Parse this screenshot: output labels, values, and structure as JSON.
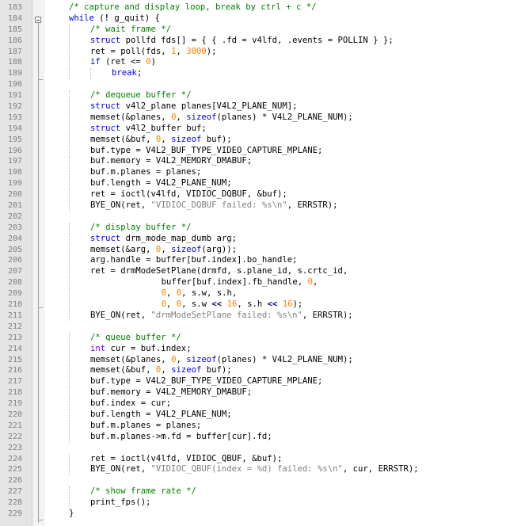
{
  "editor": {
    "lines": [
      {
        "n": "183",
        "indent": 1,
        "tokens": [
          [
            "cm",
            "/* capture and display loop, break by ctrl + c */"
          ]
        ]
      },
      {
        "n": "184",
        "indent": 1,
        "tokens": [
          [
            "kw",
            "while"
          ],
          [
            "tx",
            " ("
          ],
          [
            "op",
            "!"
          ],
          [
            "tx",
            " g_quit) {"
          ]
        ]
      },
      {
        "n": "185",
        "indent": 2,
        "tokens": [
          [
            "cm",
            "/* wait frame */"
          ]
        ]
      },
      {
        "n": "186",
        "indent": 2,
        "tokens": [
          [
            "kw",
            "struct"
          ],
          [
            "tx",
            " pollfd fds[] = { { .fd = v4lfd, .events = POLLIN } };"
          ]
        ]
      },
      {
        "n": "187",
        "indent": 2,
        "tokens": [
          [
            "tx",
            "ret = poll(fds, "
          ],
          [
            "nm",
            "1"
          ],
          [
            "tx",
            ", "
          ],
          [
            "nm",
            "3000"
          ],
          [
            "tx",
            ");"
          ]
        ]
      },
      {
        "n": "188",
        "indent": 2,
        "tokens": [
          [
            "kw",
            "if"
          ],
          [
            "tx",
            " (ret <= "
          ],
          [
            "nm",
            "0"
          ],
          [
            "tx",
            ")"
          ]
        ]
      },
      {
        "n": "189",
        "indent": 3,
        "tokens": [
          [
            "kw",
            "break"
          ],
          [
            "tx",
            ";"
          ]
        ]
      },
      {
        "n": "190",
        "indent": 0,
        "tokens": []
      },
      {
        "n": "191",
        "indent": 2,
        "tokens": [
          [
            "cm",
            "/* dequeue buffer */"
          ]
        ]
      },
      {
        "n": "192",
        "indent": 2,
        "tokens": [
          [
            "kw",
            "struct"
          ],
          [
            "tx",
            " v4l2_plane planes[V4L2_PLANE_NUM];"
          ]
        ]
      },
      {
        "n": "193",
        "indent": 2,
        "tokens": [
          [
            "tx",
            "memset(&planes, "
          ],
          [
            "nm",
            "0"
          ],
          [
            "tx",
            ", "
          ],
          [
            "kw",
            "sizeof"
          ],
          [
            "tx",
            "(planes) * V4L2_PLANE_NUM);"
          ]
        ]
      },
      {
        "n": "194",
        "indent": 2,
        "tokens": [
          [
            "kw",
            "struct"
          ],
          [
            "tx",
            " v4l2_buffer buf;"
          ]
        ]
      },
      {
        "n": "195",
        "indent": 2,
        "tokens": [
          [
            "tx",
            "memset(&buf, "
          ],
          [
            "nm",
            "0"
          ],
          [
            "tx",
            ", "
          ],
          [
            "kw",
            "sizeof"
          ],
          [
            "tx",
            " buf);"
          ]
        ]
      },
      {
        "n": "196",
        "indent": 2,
        "tokens": [
          [
            "tx",
            "buf.type = V4L2_BUF_TYPE_VIDEO_CAPTURE_MPLANE;"
          ]
        ]
      },
      {
        "n": "197",
        "indent": 2,
        "tokens": [
          [
            "tx",
            "buf.memory = V4L2_MEMORY_DMABUF;"
          ]
        ]
      },
      {
        "n": "198",
        "indent": 2,
        "tokens": [
          [
            "tx",
            "buf.m.planes = planes;"
          ]
        ]
      },
      {
        "n": "199",
        "indent": 2,
        "tokens": [
          [
            "tx",
            "buf.length = V4L2_PLANE_NUM;"
          ]
        ]
      },
      {
        "n": "200",
        "indent": 2,
        "tokens": [
          [
            "tx",
            "ret = ioctl(v4lfd, VIDIOC_DQBUF, &buf);"
          ]
        ]
      },
      {
        "n": "201",
        "indent": 2,
        "tokens": [
          [
            "tx",
            "BYE_ON(ret, "
          ],
          [
            "st",
            "\"VIDIOC_DQBUF failed: %s\\n\""
          ],
          [
            "tx",
            ", ERRSTR);"
          ]
        ]
      },
      {
        "n": "202",
        "indent": 0,
        "tokens": []
      },
      {
        "n": "203",
        "indent": 2,
        "tokens": [
          [
            "cm",
            "/* display buffer */"
          ]
        ]
      },
      {
        "n": "204",
        "indent": 2,
        "tokens": [
          [
            "kw",
            "struct"
          ],
          [
            "tx",
            " drm_mode_map_dumb arg;"
          ]
        ]
      },
      {
        "n": "205",
        "indent": 2,
        "tokens": [
          [
            "tx",
            "memset(&arg, "
          ],
          [
            "nm",
            "0"
          ],
          [
            "tx",
            ", "
          ],
          [
            "kw",
            "sizeof"
          ],
          [
            "tx",
            "(arg));"
          ]
        ]
      },
      {
        "n": "206",
        "indent": 2,
        "tokens": [
          [
            "tx",
            "arg.handle = buffer[buf.index].bo_handle;"
          ]
        ]
      },
      {
        "n": "207",
        "indent": 2,
        "tokens": [
          [
            "tx",
            "ret = drmModeSetPlane(drmfd, s.plane_id, s.crtc_id,"
          ]
        ]
      },
      {
        "n": "208",
        "indent": 2,
        "pad": 14,
        "tokens": [
          [
            "tx",
            "buffer[buf.index].fb_handle, "
          ],
          [
            "nm",
            "0"
          ],
          [
            "tx",
            ","
          ]
        ]
      },
      {
        "n": "209",
        "indent": 2,
        "pad": 14,
        "tokens": [
          [
            "nm",
            "0"
          ],
          [
            "tx",
            ", "
          ],
          [
            "nm",
            "0"
          ],
          [
            "tx",
            ", s.w, s.h,"
          ]
        ]
      },
      {
        "n": "210",
        "indent": 2,
        "pad": 14,
        "tokens": [
          [
            "nm",
            "0"
          ],
          [
            "tx",
            ", "
          ],
          [
            "nm",
            "0"
          ],
          [
            "tx",
            ", s.w "
          ],
          [
            "op",
            "<<"
          ],
          [
            "tx",
            " "
          ],
          [
            "nm",
            "16"
          ],
          [
            "tx",
            ", s.h "
          ],
          [
            "op",
            "<<"
          ],
          [
            "tx",
            " "
          ],
          [
            "nm",
            "16"
          ],
          [
            "tx",
            ");"
          ]
        ]
      },
      {
        "n": "211",
        "indent": 2,
        "tokens": [
          [
            "tx",
            "BYE_ON(ret, "
          ],
          [
            "st",
            "\"drmModeSetPlane failed: %s\\n\""
          ],
          [
            "tx",
            ", ERRSTR);"
          ]
        ]
      },
      {
        "n": "212",
        "indent": 0,
        "tokens": []
      },
      {
        "n": "213",
        "indent": 2,
        "tokens": [
          [
            "cm",
            "/* queue buffer */"
          ]
        ]
      },
      {
        "n": "214",
        "indent": 2,
        "tokens": [
          [
            "ty",
            "int"
          ],
          [
            "tx",
            " cur = buf.index;"
          ]
        ]
      },
      {
        "n": "215",
        "indent": 2,
        "tokens": [
          [
            "tx",
            "memset(&planes, "
          ],
          [
            "nm",
            "0"
          ],
          [
            "tx",
            ", "
          ],
          [
            "kw",
            "sizeof"
          ],
          [
            "tx",
            "(planes) * V4L2_PLANE_NUM);"
          ]
        ]
      },
      {
        "n": "216",
        "indent": 2,
        "tokens": [
          [
            "tx",
            "memset(&buf, "
          ],
          [
            "nm",
            "0"
          ],
          [
            "tx",
            ", "
          ],
          [
            "kw",
            "sizeof"
          ],
          [
            "tx",
            " buf);"
          ]
        ]
      },
      {
        "n": "217",
        "indent": 2,
        "tokens": [
          [
            "tx",
            "buf.type = V4L2_BUF_TYPE_VIDEO_CAPTURE_MPLANE;"
          ]
        ]
      },
      {
        "n": "218",
        "indent": 2,
        "tokens": [
          [
            "tx",
            "buf.memory = V4L2_MEMORY_DMABUF;"
          ]
        ]
      },
      {
        "n": "219",
        "indent": 2,
        "tokens": [
          [
            "tx",
            "buf.index = cur;"
          ]
        ]
      },
      {
        "n": "220",
        "indent": 2,
        "tokens": [
          [
            "tx",
            "buf.length = V4L2_PLANE_NUM;"
          ]
        ]
      },
      {
        "n": "221",
        "indent": 2,
        "tokens": [
          [
            "tx",
            "buf.m.planes = planes;"
          ]
        ]
      },
      {
        "n": "222",
        "indent": 2,
        "tokens": [
          [
            "tx",
            "buf.m.planes->m.fd = buffer[cur].fd;"
          ]
        ]
      },
      {
        "n": "223",
        "indent": 0,
        "tokens": []
      },
      {
        "n": "224",
        "indent": 2,
        "tokens": [
          [
            "tx",
            "ret = ioctl(v4lfd, VIDIOC_QBUF, &buf);"
          ]
        ]
      },
      {
        "n": "225",
        "indent": 2,
        "tokens": [
          [
            "tx",
            "BYE_ON(ret, "
          ],
          [
            "st",
            "\"VIDIOC_QBUF(index = %d) failed: %s\\n\""
          ],
          [
            "tx",
            ", cur, ERRSTR);"
          ]
        ]
      },
      {
        "n": "226",
        "indent": 0,
        "tokens": []
      },
      {
        "n": "227",
        "indent": 2,
        "tokens": [
          [
            "cm",
            "/* show frame rate */"
          ]
        ]
      },
      {
        "n": "228",
        "indent": 2,
        "tokens": [
          [
            "tx",
            "print_fps();"
          ]
        ]
      },
      {
        "n": "229",
        "indent": 1,
        "tokens": [
          [
            "tx",
            "}"
          ]
        ]
      }
    ]
  }
}
